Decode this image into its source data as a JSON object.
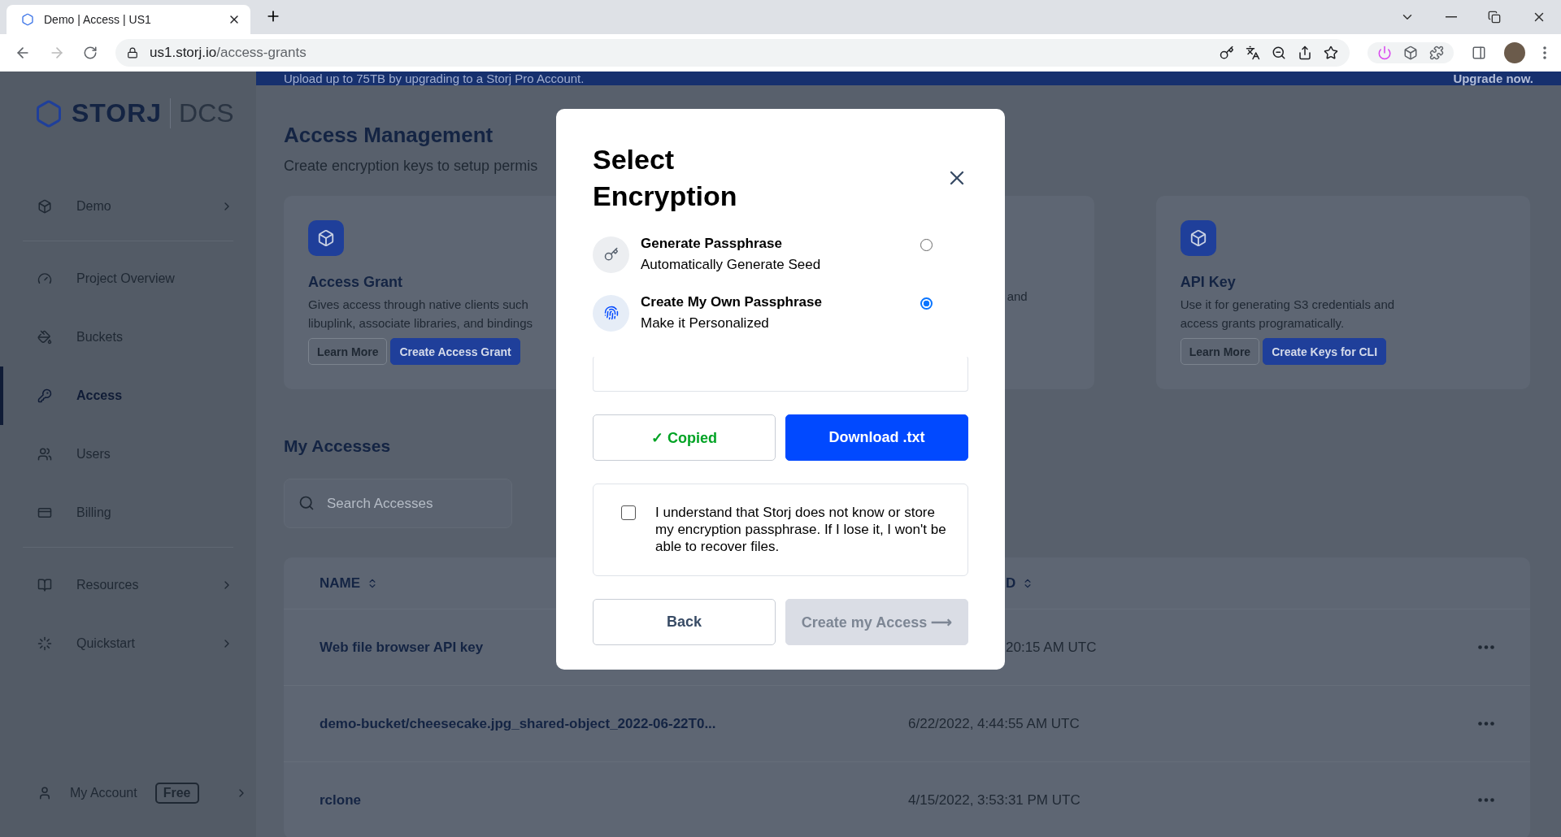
{
  "browser": {
    "tabs": [
      {
        "title": "Demo | Access | US1",
        "selected": true
      }
    ],
    "url_host": "us1.storj.io",
    "url_path": "/access-grants"
  },
  "banner": {
    "text": "Upload up to 75TB by upgrading to a Storj Pro Account.",
    "link": "Upgrade now."
  },
  "sidebar": {
    "logo": {
      "brand": "STORJ",
      "product": "DCS"
    },
    "items": [
      {
        "label": "Demo",
        "chevron": true,
        "selected": false,
        "divider_after": true
      },
      {
        "label": "Project Overview",
        "chevron": false,
        "selected": false
      },
      {
        "label": "Buckets",
        "chevron": false,
        "selected": false
      },
      {
        "label": "Access",
        "chevron": false,
        "selected": true
      },
      {
        "label": "Users",
        "chevron": false,
        "selected": false
      },
      {
        "label": "Billing",
        "chevron": false,
        "selected": false,
        "divider_after": true
      },
      {
        "label": "Resources",
        "chevron": true,
        "selected": false
      },
      {
        "label": "Quickstart",
        "chevron": true,
        "selected": false
      }
    ],
    "account": {
      "label": "My Account",
      "badge": "Free"
    }
  },
  "main": {
    "title": "Access Management",
    "subtitle": "Create encryption keys to setup permis",
    "cards": [
      {
        "title": "Access Grant",
        "description": "Gives access through native clients such libuplink, associate libraries, and bindings",
        "buttons": [
          "Learn More",
          "Create Access Grant"
        ]
      },
      {
        "description": "and"
      },
      {
        "title": "API Key",
        "description": "Use it for generating S3 credentials and access grants programatically.",
        "buttons": [
          "Learn More",
          "Create Keys for CLI"
        ]
      }
    ],
    "accesses_title": "My Accesses",
    "search": {
      "placeholder": "Search Accesses"
    },
    "table": {
      "columns": [
        "NAME",
        "D"
      ],
      "rows": [
        {
          "name": "Web file browser API key",
          "date": "20:15 AM UTC"
        },
        {
          "name": "demo-bucket/cheesecake.jpg_shared-object_2022-06-22T0...",
          "date": "6/22/2022, 4:44:55 AM UTC"
        },
        {
          "name": "rclone",
          "date": "4/15/2022, 3:53:31 PM UTC"
        }
      ]
    }
  },
  "modal": {
    "title": "Select Encryption",
    "options": [
      {
        "title": "Generate Passphrase",
        "subtitle": "Automatically Generate Seed",
        "selected": false
      },
      {
        "title": "Create My Own Passphrase",
        "subtitle": "Make it Personalized",
        "selected": true
      }
    ],
    "copy_button": "✓ Copied",
    "download_button": "Download .txt",
    "acknowledge": {
      "text": "I understand that Storj does not know or store my encryption passphrase. If I lose it, I won't be able to recover files.",
      "checked": false
    },
    "back_button": "Back",
    "create_button": {
      "label": "Create my Access ⟶",
      "disabled": true
    }
  }
}
